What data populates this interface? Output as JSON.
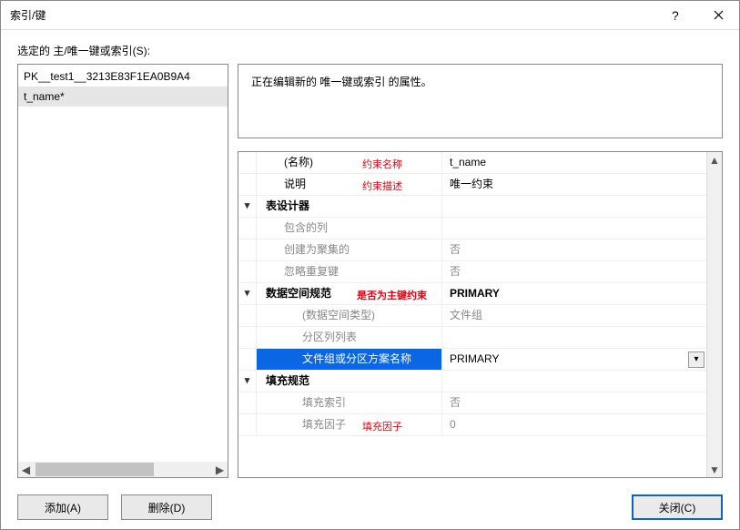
{
  "titlebar": {
    "title": "索引/键"
  },
  "toplabel": "选定的 主/唯一键或索引(S):",
  "list": {
    "items": [
      "PK__test1__3213E83F1EA0B9A4",
      "t_name*"
    ],
    "selected_index": 1
  },
  "buttons": {
    "add": "添加(A)",
    "delete": "删除(D)",
    "close": "关闭(C)"
  },
  "description": "正在编辑新的 唯一键或索引 的属性。",
  "annotations": {
    "name": "约束名称",
    "desc": "约束描述",
    "isPk": "是否为主键约束",
    "fill": "填充因子"
  },
  "props": [
    {
      "kind": "row",
      "indent": 1,
      "label": "(名称)",
      "value": "t_name",
      "annot": "name"
    },
    {
      "kind": "row",
      "indent": 1,
      "label": "说明",
      "value": "唯一约束",
      "annot": "desc"
    },
    {
      "kind": "group",
      "label": "表设计器",
      "expanded": true
    },
    {
      "kind": "row",
      "indent": 1,
      "label": "包含的列",
      "value": "",
      "disabled": true
    },
    {
      "kind": "row",
      "indent": 1,
      "label": "创建为聚集的",
      "value": "否",
      "disabled": true
    },
    {
      "kind": "row",
      "indent": 1,
      "label": "忽略重复键",
      "value": "否",
      "disabled": true
    },
    {
      "kind": "group",
      "label": "数据空间规范",
      "value": "PRIMARY",
      "expanded": true,
      "annot": "isPk"
    },
    {
      "kind": "row",
      "indent": 2,
      "label": "(数据空间类型)",
      "value": "文件组",
      "disabled": true
    },
    {
      "kind": "row",
      "indent": 2,
      "label": "分区列列表",
      "value": "",
      "disabled": true
    },
    {
      "kind": "row",
      "indent": 2,
      "label": "文件组或分区方案名称",
      "value": "PRIMARY",
      "selected": true,
      "dropdown": true
    },
    {
      "kind": "group",
      "label": "填充规范",
      "expanded": true
    },
    {
      "kind": "row",
      "indent": 2,
      "label": "填充索引",
      "value": "否",
      "disabled": true
    },
    {
      "kind": "row",
      "indent": 2,
      "label": "填充因子",
      "value": "0",
      "disabled": true,
      "annot": "fill"
    }
  ]
}
